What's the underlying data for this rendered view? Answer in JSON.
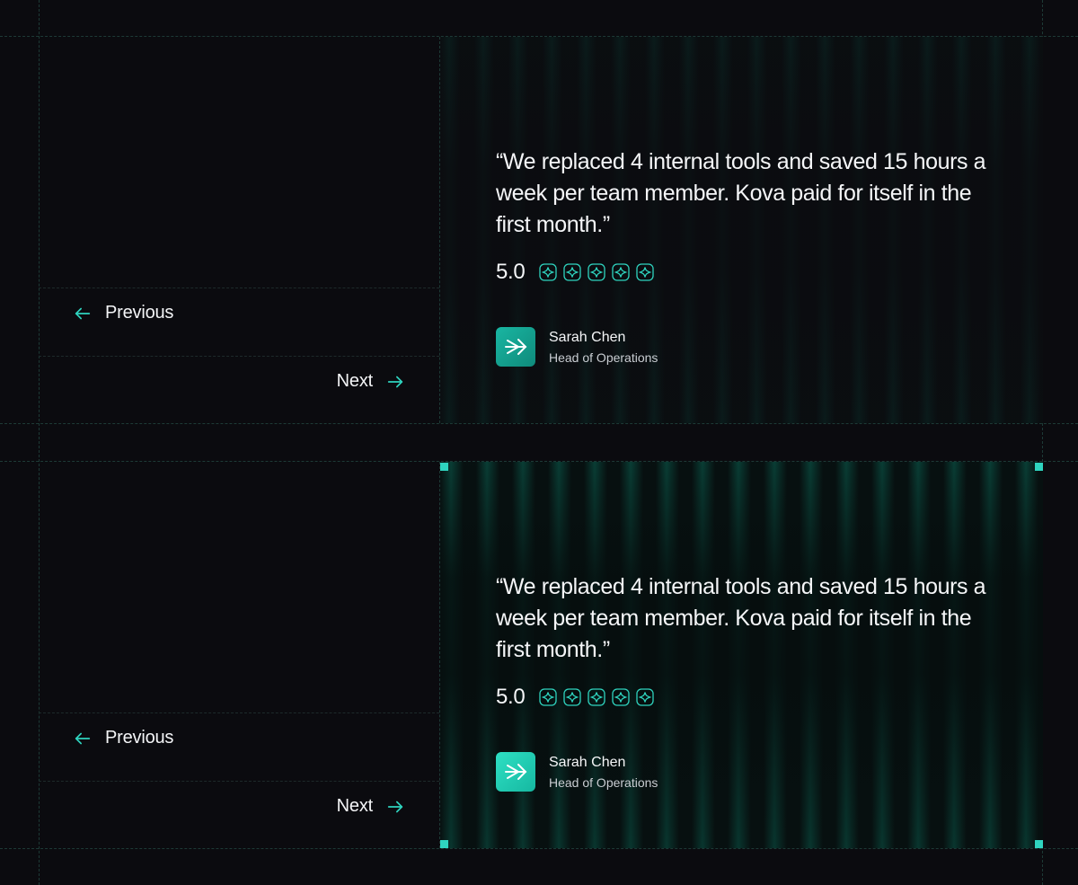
{
  "theme": {
    "accent": "#2fd4bf",
    "background": "#0b0b0f"
  },
  "cards": [
    {
      "state": "default",
      "nav": {
        "prev_label": "Previous",
        "next_label": "Next"
      },
      "testimonial": {
        "quote": "“We replaced 4 internal tools and saved 15 hours a week per team member. Kova paid for itself in the first month.”",
        "rating": "5.0",
        "stars": 5,
        "author_name": "Sarah Chen",
        "author_role": "Head of Operations"
      }
    },
    {
      "state": "selected",
      "nav": {
        "prev_label": "Previous",
        "next_label": "Next"
      },
      "testimonial": {
        "quote": "“We replaced 4 internal tools and saved 15 hours a week per team member. Kova paid for itself in the first month.”",
        "rating": "5.0",
        "stars": 5,
        "author_name": "Sarah Chen",
        "author_role": "Head of Operations"
      }
    }
  ],
  "icons": {
    "prev": "arrow-left-icon",
    "next": "arrow-right-icon",
    "star": "sparkle-star-icon",
    "avatar": "arrow-burst-logo-icon"
  }
}
